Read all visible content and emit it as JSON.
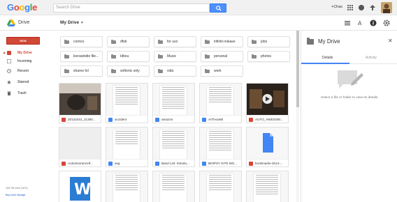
{
  "header": {
    "logo_text": "Google",
    "search_placeholder": "Search Drive",
    "user_name": "+Chas"
  },
  "subheader": {
    "app_name": "Drive",
    "location_title": "My Drive"
  },
  "sidebar": {
    "new_label": "NEW",
    "items": [
      {
        "label": "My Drive",
        "icon": "drive-icon",
        "active": true
      },
      {
        "label": "Incoming",
        "icon": "inbox-icon"
      },
      {
        "label": "Recent",
        "icon": "clock-icon"
      },
      {
        "label": "Starred",
        "icon": "star-icon"
      },
      {
        "label": "Trash",
        "icon": "trash-icon"
      }
    ],
    "storage_text": "166 GB used (16%)",
    "buy_storage": "Buy more storage"
  },
  "folders": [
    {
      "label": "comics"
    },
    {
      "label": "dfsb"
    },
    {
      "label": "for uvo"
    },
    {
      "label": "infiniti release"
    },
    {
      "label": "jobs"
    },
    {
      "label": "koreainidie file..."
    },
    {
      "label": "Idtiou"
    },
    {
      "label": "Music"
    },
    {
      "label": "personal"
    },
    {
      "label": "photos"
    },
    {
      "label": "shares fol"
    },
    {
      "label": "softonic only"
    },
    {
      "label": "vida"
    },
    {
      "label": "work"
    }
  ],
  "files": [
    {
      "label": "20131031_21350...",
      "type": "image"
    },
    {
      "label": "accident",
      "type": "doc"
    },
    {
      "label": "amazon",
      "type": "doc"
    },
    {
      "label": "ArtTvoo80",
      "type": "doc"
    },
    {
      "label": "AUTO_AWESOM...",
      "type": "video"
    },
    {
      "label": "AutoInsuranceIf...",
      "type": "pdf"
    },
    {
      "label": "avg",
      "type": "doc"
    },
    {
      "label": "Band List: Introdu...",
      "type": "doc"
    },
    {
      "label": "BIOPSY SITE MO...",
      "type": "doc"
    },
    {
      "label": "bookmarks-2014-...",
      "type": "html"
    }
  ],
  "details_panel": {
    "title": "My Drive",
    "tab_details": "Details",
    "tab_activity": "Activity",
    "empty_message": "Select a file or folder to view its details."
  },
  "colors": {
    "accent_blue": "#4285f4",
    "new_button": "#d14836",
    "doc_blue": "#4285f4",
    "pdf_red": "#db4437"
  }
}
